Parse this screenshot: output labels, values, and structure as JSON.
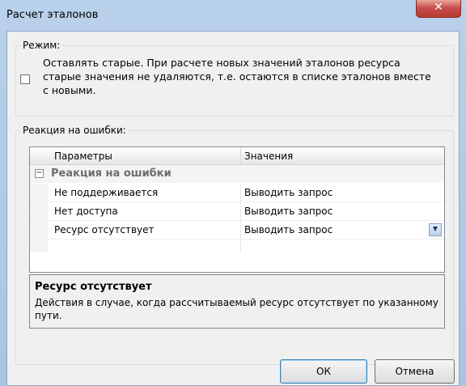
{
  "window": {
    "title": "Расчет эталонов"
  },
  "mode": {
    "legend": "Режим:",
    "checkbox_text": "Оставлять старые. При расчете новых значений эталонов ресурса старые значения не удаляются, т.е. остаются в списке эталонов вместе с новыми.",
    "checked": false
  },
  "errors": {
    "legend": "Реакция на ошибки:",
    "grid": {
      "col_params": "Параметры",
      "col_values": "Значения",
      "category": "Реакция на ошибки",
      "rows": [
        {
          "name": "Не поддерживается",
          "value": "Выводить запрос"
        },
        {
          "name": "Нет доступа",
          "value": "Выводить запрос"
        },
        {
          "name": "Ресурс отсутствует",
          "value": "Выводить запрос"
        }
      ]
    },
    "help": {
      "title": "Ресурс отсутствует",
      "text": "Действия в случае, когда рассчитываемый ресурс отсутствует по указанному пути."
    }
  },
  "buttons": {
    "ok": "ОК",
    "cancel": "Отмена"
  }
}
